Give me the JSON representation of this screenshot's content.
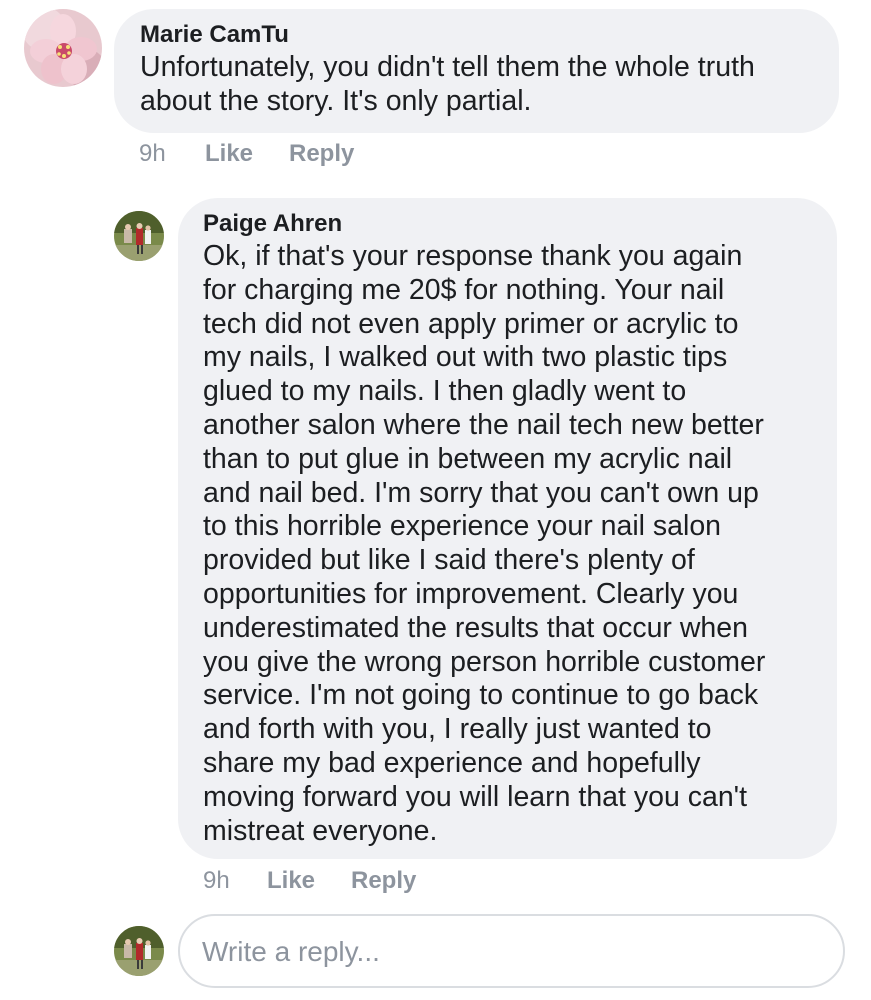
{
  "comments": [
    {
      "author": "Marie CamTu",
      "avatar_icon": "pink-flower-avatar",
      "lines": [
        "Unfortunately, you didn't tell them the whole truth",
        "about the story. It's only partial."
      ],
      "time": "9h",
      "like_label": "Like",
      "reply_label": "Reply"
    },
    {
      "author": "Paige Ahren",
      "avatar_icon": "outdoor-people-photo-avatar",
      "lines": [
        "Ok, if that's your response thank you again",
        "for charging me 20$ for nothing. Your nail",
        "tech did not even apply primer or acrylic to",
        "my nails, I walked out with two plastic tips",
        "glued to my nails. I then gladly went to",
        "another salon where the nail tech new better",
        "than to put glue in between my acrylic nail",
        "and nail bed. I'm sorry that you can't own up",
        "to this horrible experience your nail salon",
        "provided but like I said there's plenty of",
        "opportunities for improvement. Clearly you",
        "underestimated the results that occur when",
        "you give the wrong person horrible customer",
        "service. I'm not going to continue to go back",
        "and forth with you, I really just wanted to",
        "share my bad experience and hopefully",
        "moving forward you will learn that you can't",
        "mistreat everyone."
      ],
      "time": "9h",
      "like_label": "Like",
      "reply_label": "Reply"
    }
  ],
  "reply_input": {
    "placeholder": "Write a reply...",
    "value": ""
  },
  "colors": {
    "bubble": "#f0f1f4",
    "text": "#1c1e21",
    "meta": "#8d949e",
    "input_border": "#dadde1"
  }
}
